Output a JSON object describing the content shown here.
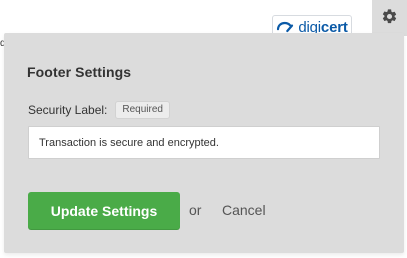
{
  "background": {
    "partial_text": "d",
    "badge": {
      "brand_prefix": "digi",
      "brand_suffix": "cert",
      "brand_color": "#0b5aa7"
    }
  },
  "toolbar": {
    "settings_icon": "gear-icon"
  },
  "panel": {
    "title": "Footer Settings",
    "field": {
      "label": "Security Label:",
      "required_badge": "Required",
      "value": "Transaction is secure and encrypted.",
      "placeholder": ""
    },
    "actions": {
      "update_label": "Update Settings",
      "or_label": "or",
      "cancel_label": "Cancel"
    }
  },
  "colors": {
    "panel_bg": "#dcdcdc",
    "accent_green": "#4aab48",
    "text_dark": "#333333",
    "text_muted": "#555555"
  }
}
